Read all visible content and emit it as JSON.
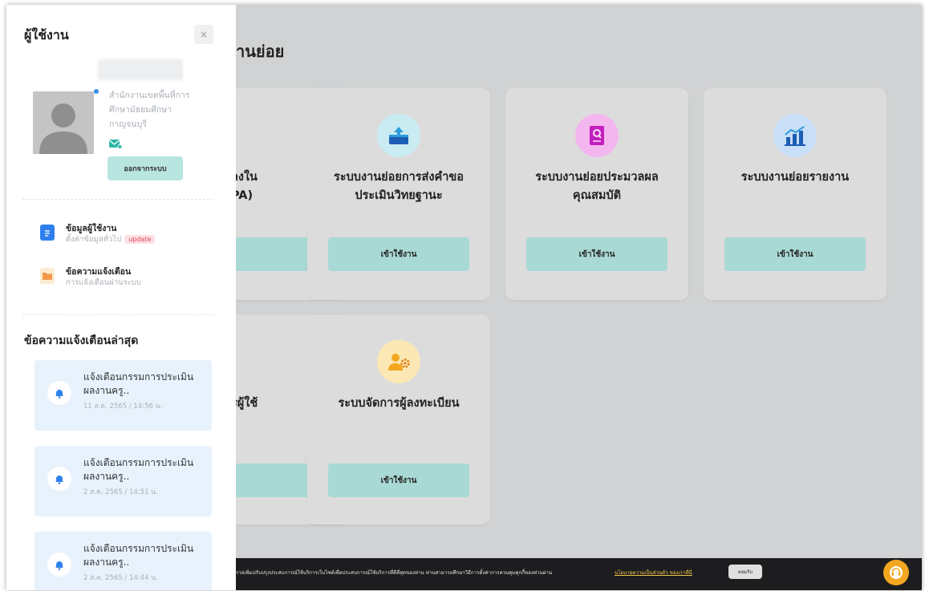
{
  "main": {
    "title_partial": "านย่อย",
    "cards": [
      {
        "title_line1": "ลงใน",
        "title_line2": "PA)",
        "button": ""
      },
      {
        "title_line1": "ระบบงานย่อยการส่งคำขอ",
        "title_line2": "ประเมินวิทยฐานะ",
        "button": "เข้าใช้งาน",
        "icon": "upload-box-icon"
      },
      {
        "title_line1": "ระบบงานย่อยประมวลผล",
        "title_line2": "คุณสมบัติ",
        "button": "เข้าใช้งาน",
        "icon": "document-search-icon"
      },
      {
        "title_line1": "ระบบงานย่อยรายงาน",
        "title_line2": "",
        "button": "เข้าใช้งาน",
        "icon": "report-chart-icon"
      },
      {
        "title_line1": "รผู้ใช้",
        "title_line2": "",
        "button": ""
      },
      {
        "title_line1": "ระบบจัดการผู้ลงทะเบียน",
        "title_line2": "",
        "button": "เข้าใช้งาน",
        "icon": "user-gear-icon"
      }
    ]
  },
  "cookie_bar": {
    "text": "รวจเพิ่มปรับปรุงประสบการณ์ใช้บริการเว็บไซต์เพื่อประสบการณ์ใช้บริการที่ดีที่สุดของท่าน ท่านสามารถศึกษาวิธีการตั้งค่าการควบคุมคุกกี้ของท่านผ่าน",
    "link": "นโยบายความเป็นส่วนตัว ของเราที่นี่",
    "accept": "ยอมรับ"
  },
  "panel": {
    "title": "ผู้ใช้งาน",
    "close": "×",
    "org_line1": "สำนักงานเขตพื้นที่การ",
    "org_line2": "ศึกษามัธยมศึกษา",
    "org_line3": "กาญจนบุรี",
    "logout": "ออกจากระบบ",
    "menu": [
      {
        "title": "ข้อมูลผู้ใช้งาน",
        "subtitle": "ตั้งค่าข้อมูลทั่วไป",
        "badge": "update",
        "icon": "document-icon"
      },
      {
        "title": "ข้อความแจ้งเตือน",
        "subtitle": "การแจ้งเตือนผ่านระบบ",
        "icon": "folder-icon"
      }
    ],
    "notif_title": "ข้อความแจ้งเตือนล่าสุด",
    "notifications": [
      {
        "line1": "แจ้งเตือนกรรมการประเมิน",
        "line2": "ผลงานครู..",
        "date": "11 ส.ค. 2565 / 14:56 น."
      },
      {
        "line1": "แจ้งเตือนกรรมการประเมิน",
        "line2": "ผลงานครู..",
        "date": "2 ส.ค. 2565 / 14:51 น."
      },
      {
        "line1": "แจ้งเตือนกรรมการประเมิน",
        "line2": "ผลงานครู..",
        "date": "2 ส.ค. 2565 / 14:44 น."
      }
    ]
  },
  "colors": {
    "accent": "#a9d9d4",
    "panel_bg": "#ffffff",
    "overlay": "#d1d2d3",
    "help": "#f3a620",
    "badge": "#e04c5e"
  }
}
